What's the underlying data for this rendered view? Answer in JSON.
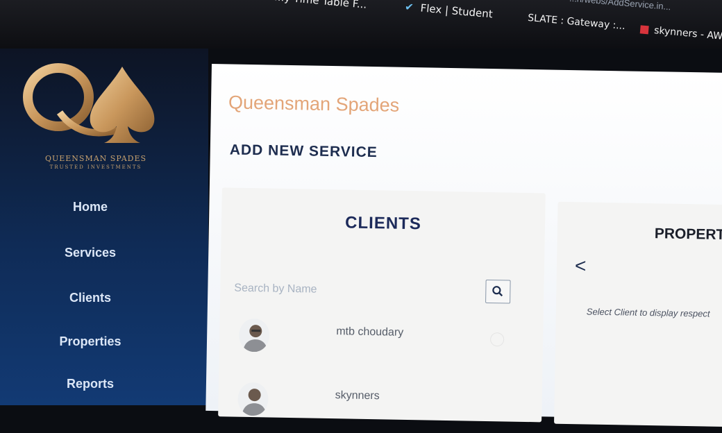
{
  "browser": {
    "bookmarks": [
      {
        "label": "...y Time Table F..."
      },
      {
        "label": "Flex | Student"
      },
      {
        "label": "SLATE : Gateway :..."
      },
      {
        "label": "skynners - AW..."
      }
    ],
    "url": "...n/webs/AddService.in..."
  },
  "sidebar": {
    "logo_name": "QUEENSMAN SPADES",
    "logo_tagline": "TRUSTED INVESTMENTS",
    "items": [
      {
        "label": "Home"
      },
      {
        "label": "Services"
      },
      {
        "label": "Clients"
      },
      {
        "label": "Properties"
      },
      {
        "label": "Reports"
      }
    ]
  },
  "main": {
    "brand": "Queensman Spades",
    "page_title": "ADD NEW SERVICE",
    "clients": {
      "title": "CLIENTS",
      "search_placeholder": "Search by Name",
      "list": [
        {
          "name": "mtb choudary"
        },
        {
          "name": "skynners"
        }
      ]
    },
    "properties": {
      "title": "PROPERT",
      "back_label": "<",
      "empty_message": "Select Client to display respect"
    }
  },
  "colors": {
    "sidebar_bg": "#0f2b56",
    "brand_accent": "#e3a578",
    "title_navy": "#1d2d4f",
    "logo_gold": "#c7a16e"
  }
}
